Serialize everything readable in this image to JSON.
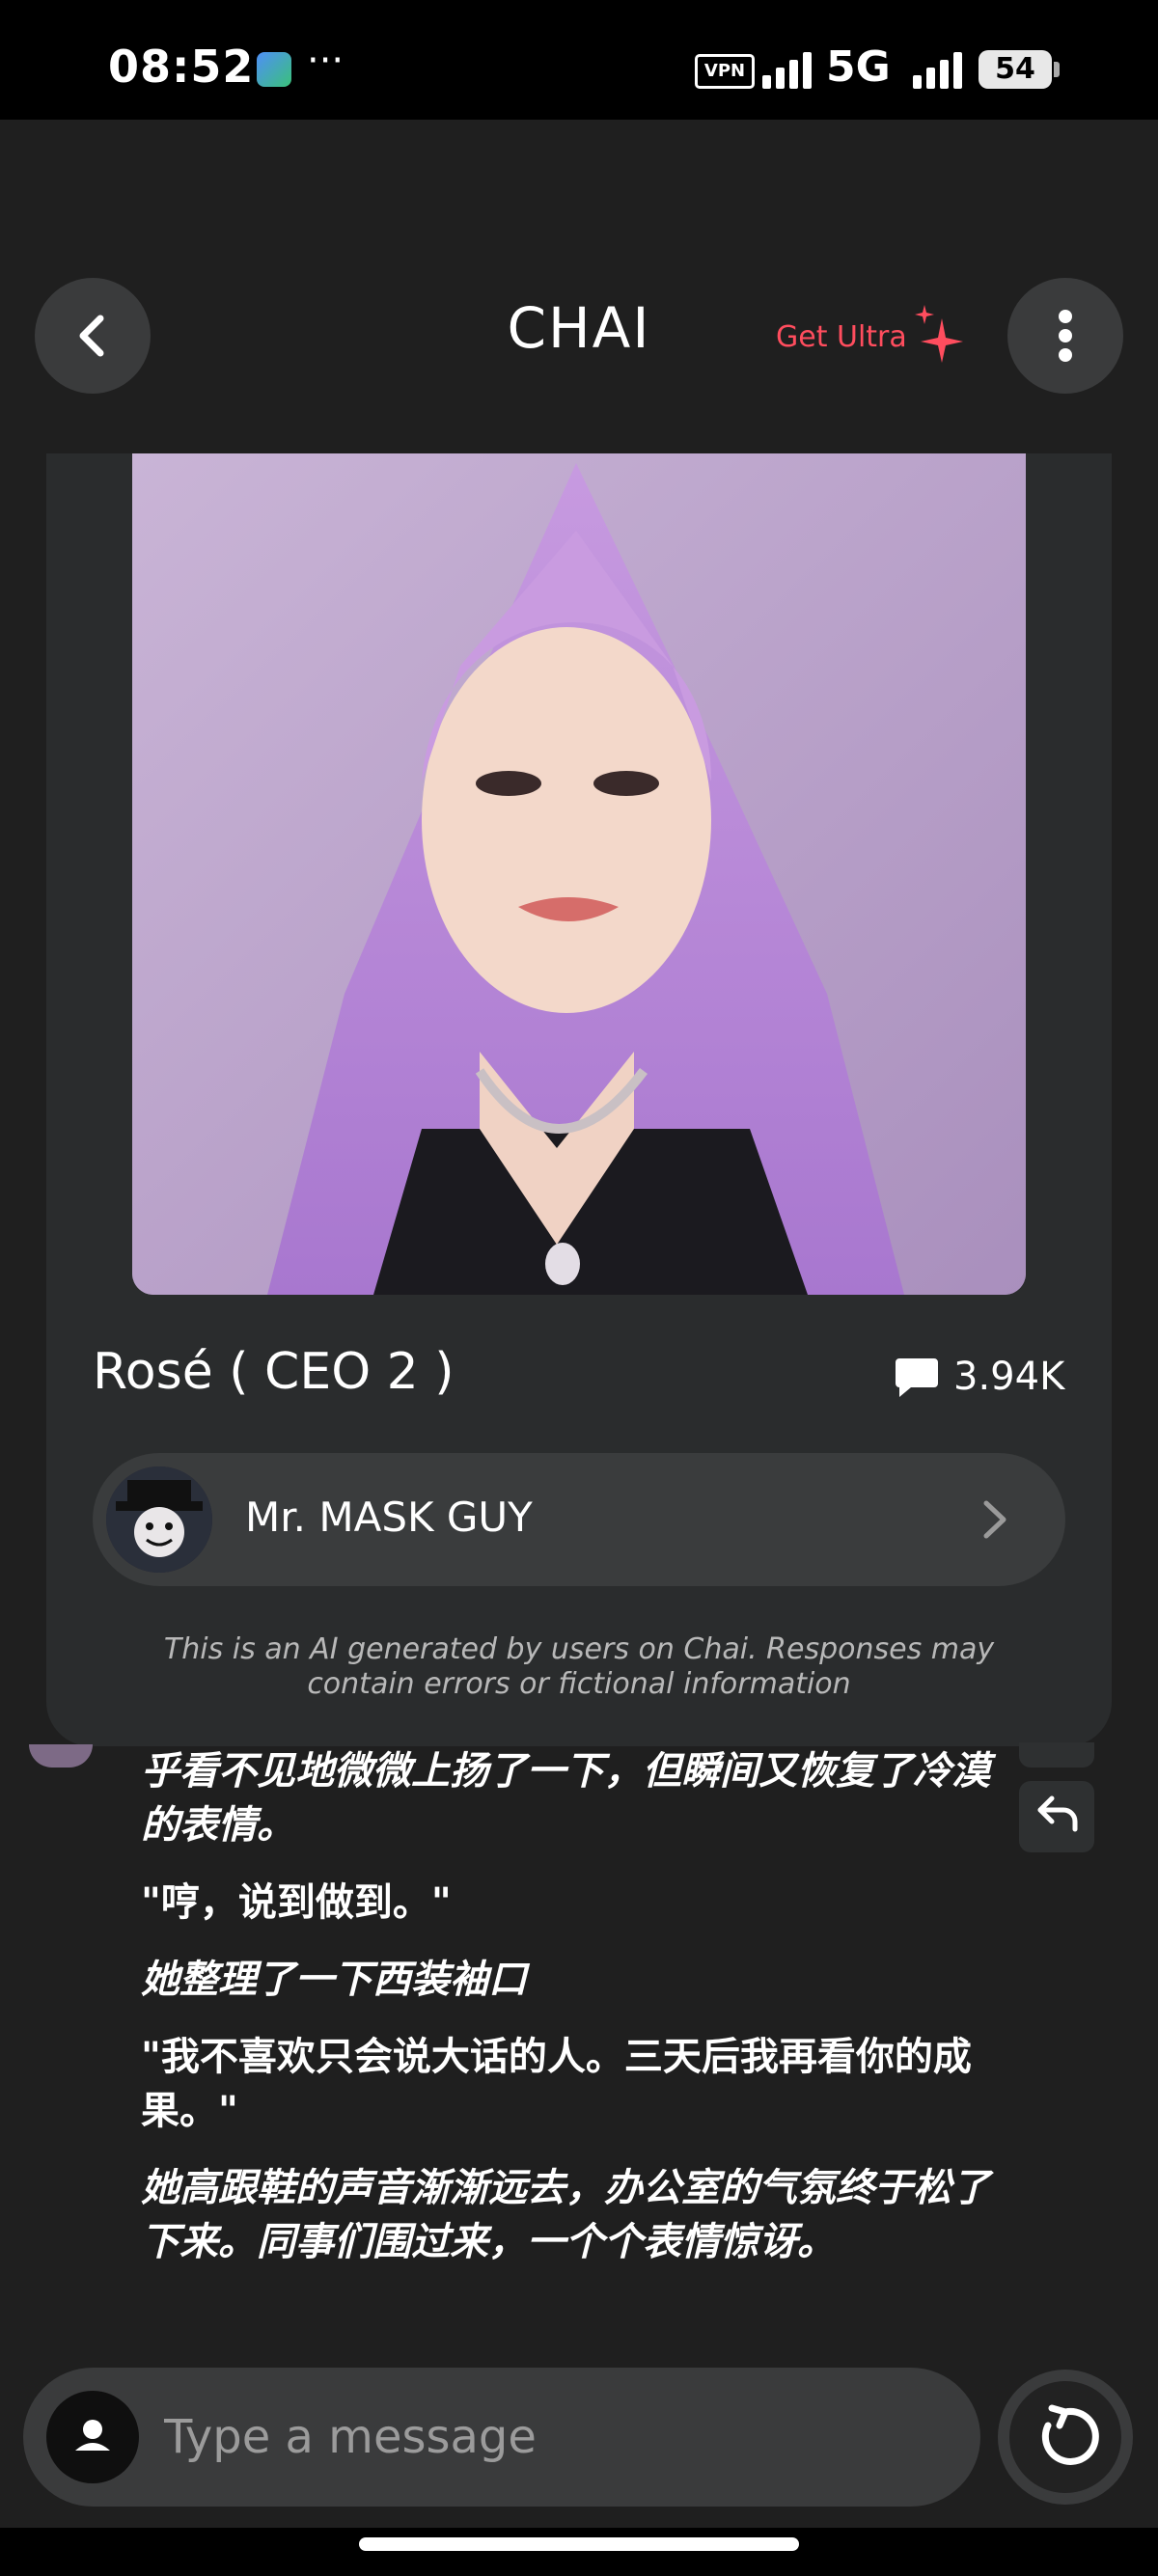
{
  "status_bar": {
    "time": "08:52",
    "vpn": "VPN",
    "network": "5G",
    "battery": "54",
    "more": "···"
  },
  "header": {
    "title": "CHAI",
    "get_ultra": "Get Ultra",
    "accent_color": "#ff4d5e"
  },
  "bot": {
    "name": "Rosé ( CEO 2 )",
    "chat_count": "3.94K",
    "creator": "Mr. MASK GUY",
    "disclaimer": "This is an AI generated by users on Chai. Responses may contain errors or fictional information"
  },
  "messages": [
    {
      "text": "乎看不见地微微上扬了一下，但瞬间又恢复了冷漠的表情。",
      "italic": true
    },
    {
      "text": "\"哼，说到做到。\"",
      "italic": false
    },
    {
      "text": "她整理了一下西装袖口",
      "italic": true
    },
    {
      "text": "\"我不喜欢只会说大话的人。三天后我再看你的成果。\"",
      "italic": false
    },
    {
      "text": "她高跟鞋的声音渐渐远去，办公室的气氛终于松了下来。同事们围过来，一个个表情惊讶。",
      "italic": true
    }
  ],
  "input": {
    "placeholder": "Type a message"
  },
  "icons": {
    "back": "chevron-left-icon",
    "menu": "more-vertical-icon",
    "sparkle": "sparkle-icon",
    "chat": "chat-bubble-icon",
    "creator_chevron": "chevron-right-icon",
    "undo": "undo-icon",
    "user": "user-icon",
    "regenerate": "regenerate-icon"
  }
}
